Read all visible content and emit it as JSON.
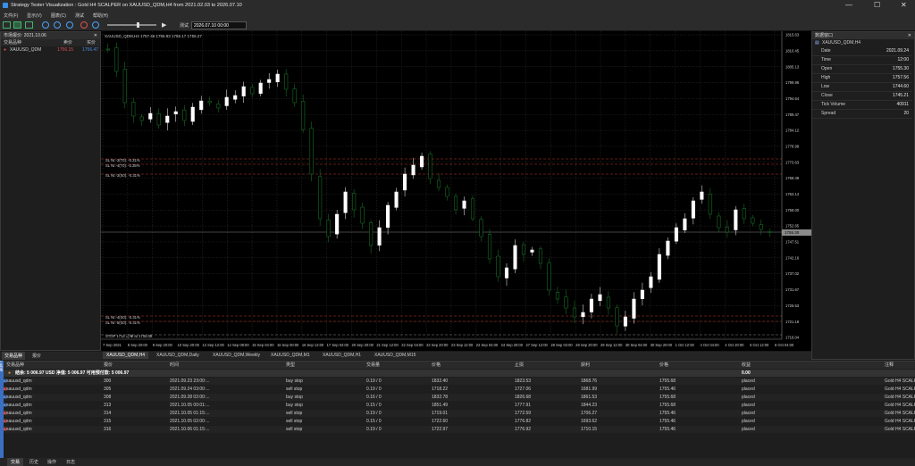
{
  "window": {
    "title": "Strategy Tester Visualization : Gold H4 SCALPER on XAUUSD_QDM,H4 from 2021.02.03 to 2026.07.10",
    "controls": [
      "—",
      "☐",
      "✕"
    ]
  },
  "menu": [
    "文件(F)",
    "显示(V)",
    "图表(C)",
    "测试",
    "帮助(H)"
  ],
  "toolbar": {
    "speed_label": "测试",
    "date_value": "2026.07.10 00:00"
  },
  "market_watch": {
    "title": "市场报价: 2021.10.06",
    "col_symbol": "交易品种",
    "col_bid": "卖价",
    "col_ask": "买价",
    "rows": [
      {
        "symbol": "XAUUSD_QDM",
        "bid": "1756.15",
        "ask": "1756.47"
      }
    ],
    "tabs": [
      "交易品种",
      "报价"
    ]
  },
  "chart": {
    "info": "XAUUSD_QDM,H4  1757.46 1755.93 1755.17 1755.27",
    "price_labels": [
      "1815.63",
      "1810.45",
      "1805.13",
      "1799.96",
      "1794.64",
      "1789.47",
      "1784.12",
      "1778.98",
      "1773.63",
      "1768.49",
      "1763.14",
      "1758.00",
      "1752.65",
      "1747.51",
      "1742.16",
      "1737.02",
      "1731.67",
      "1726.53",
      "1721.18",
      "1716.04"
    ],
    "current_price": "1755.30",
    "time_labels": [
      "7 Sep 2021",
      "8 Sep 20:00",
      "9 Sep 20:00",
      "10 Sep 20:00",
      "13 Sep 12:00",
      "14 Sep 08:00",
      "15 Sep 04:00",
      "16 Sep 00:00",
      "16 Sep 12:00",
      "17 Sep 04:00",
      "20 Sep 20:00",
      "21 Sep 12:00",
      "22 Sep 04:00",
      "22 Sep 20:00",
      "23 Sep 12:00",
      "24 Sep 04:00",
      "24 Sep 20:00",
      "27 Sep 12:00",
      "28 Sep 04:00",
      "28 Sep 20:00",
      "29 Sep 12:00",
      "30 Sep 04:00",
      "30 Sep 20:00",
      "1 Oct 12:00",
      "4 Oct 04:00",
      "4 Oct 20:00",
      "5 Oct 12:00",
      "6 Oct 04:00"
    ],
    "line_labels": {
      "sl1": "SL Nr.-3(T0): -0.31%",
      "sl2": "SL Nr.-4(T0): -0.35%",
      "sl3": "SL Nr.-3(S0): -0.31%",
      "sl4": "SL Nr.-4(S0): -0.31%",
      "sl5": "SL Nr.-5(S0): -0.31%",
      "bottom": "STOP 1714 订单 at 1706.08"
    },
    "chart_tabs": [
      "XAUUSD_QDM,H4",
      "XAUUSD_QDM,Daily",
      "XAUUSD_QDM,Weekly",
      "XAUUSD_QDM,M1",
      "XAUUSD_QDM,H1",
      "XAUUSD_QDM,M15"
    ]
  },
  "data_window": {
    "title": "数据窗口",
    "symbol": "XAUUSD_QDM,H4",
    "rows": [
      {
        "k": "Date",
        "v": "2021.09.24"
      },
      {
        "k": "Time",
        "v": "12:00"
      },
      {
        "k": "Open",
        "v": "1755.30"
      },
      {
        "k": "High",
        "v": "1757.56"
      },
      {
        "k": "Low",
        "v": "1744.60"
      },
      {
        "k": "Close",
        "v": "1745.21"
      },
      {
        "k": "Tick Volume",
        "v": "40911"
      },
      {
        "k": "Spread",
        "v": "20"
      }
    ]
  },
  "orders": {
    "headers": [
      "交易品种",
      "报价",
      "时间",
      "类型",
      "交易量",
      "价格",
      "止损",
      "获利",
      "价格",
      "收益",
      "注释"
    ],
    "balance_row": "结余: 5 006.97 USD  净值: 5 006.97  可用预付款: 5 006.97",
    "balance_value": "0.00",
    "rows": [
      {
        "symbol": "xauusd_qdm",
        "ticket": "300",
        "time": "2021.09.23 23:00:...",
        "type": "buy stop",
        "volume": "0.19 / 0",
        "price": "1832.40",
        "sl": "1823.53",
        "tp": "1868.76",
        "cur": "1755.68",
        "state": "placed",
        "comment": "Gold H4 SCALPER",
        "side": "buy"
      },
      {
        "symbol": "xauusd_qdm",
        "ticket": "305",
        "time": "2021.09.24 03:00:...",
        "type": "sell stop",
        "volume": "0.19 / 0",
        "price": "1718.22",
        "sl": "1727.06",
        "tp": "1681.99",
        "cur": "1755.46",
        "state": "placed",
        "comment": "Gold H4 SCALPER",
        "side": "sell"
      },
      {
        "symbol": "xauusd_qdm",
        "ticket": "308",
        "time": "2021.09.28 02:00:...",
        "type": "buy stop",
        "volume": "0.16 / 0",
        "price": "1832.78",
        "sl": "1826.68",
        "tp": "1861.53",
        "cur": "1755.68",
        "state": "placed",
        "comment": "Gold H4 SCALPER",
        "side": "buy"
      },
      {
        "symbol": "xauusd_qdm",
        "ticket": "313",
        "time": "2021.10.05 00:01:...",
        "type": "buy stop",
        "volume": "0.15 / 0",
        "price": "1851.49",
        "sl": "1777.91",
        "tp": "1844.23",
        "cur": "1755.68",
        "state": "placed",
        "comment": "Gold H4 SCALPER",
        "side": "buy"
      },
      {
        "symbol": "xauusd_qdm",
        "ticket": "314",
        "time": "2021.10.05 01:15:...",
        "type": "sell stop",
        "volume": "0.19 / 0",
        "price": "1719.01",
        "sl": "1772.59",
        "tp": "1706.27",
        "cur": "1755.46",
        "state": "placed",
        "comment": "Gold H4 SCALPER",
        "side": "sell"
      },
      {
        "symbol": "xauusd_qdm",
        "ticket": "315",
        "time": "2021.10.05 02:00:...",
        "type": "sell stop",
        "volume": "0.15 / 0",
        "price": "1722.60",
        "sl": "1776.82",
        "tp": "1693.62",
        "cur": "1755.46",
        "state": "placed",
        "comment": "Gold H4 SCALPER",
        "side": "sell"
      },
      {
        "symbol": "xauusd_qdm",
        "ticket": "316",
        "time": "2021.10.06 01:15:...",
        "type": "sell stop",
        "volume": "0.19 / 0",
        "price": "1722.97",
        "sl": "1776.92",
        "tp": "1710.15",
        "cur": "1755.46",
        "state": "placed",
        "comment": "Gold H4 SCALPER",
        "side": "sell"
      }
    ],
    "bottom_tabs": [
      "交易",
      "历史",
      "操作",
      "日志"
    ],
    "side_label": "工具箱"
  },
  "colors": {
    "bull": "#ffffff",
    "bear": "#1a7f2a",
    "grid": "#3a3a3a",
    "sl_line": "#c0392b",
    "price_line": "#8a8a8a"
  }
}
